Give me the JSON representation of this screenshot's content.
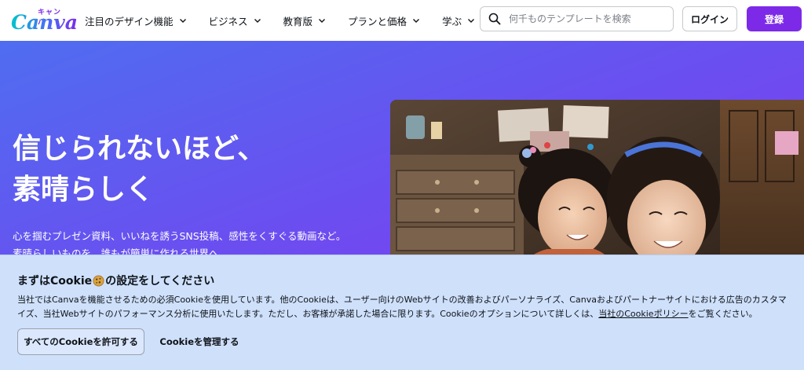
{
  "brand": {
    "logo_text": "Canva",
    "logo_kana": "キャンバ",
    "accent": "#7d2ae8"
  },
  "nav": {
    "items": [
      {
        "label": "注目のデザイン機能",
        "icon": "chevron-down-icon"
      },
      {
        "label": "ビジネス",
        "icon": "chevron-down-icon"
      },
      {
        "label": "教育版",
        "icon": "chevron-down-icon"
      },
      {
        "label": "プランと価格",
        "icon": "chevron-down-icon"
      },
      {
        "label": "学ぶ",
        "icon": "chevron-down-icon"
      }
    ]
  },
  "search": {
    "placeholder": "何千ものテンプレートを検索",
    "value": "",
    "icon": "search-icon"
  },
  "auth": {
    "login_label": "ログイン",
    "signup_label": "登録"
  },
  "hero": {
    "title_line1": "信じられないほど、",
    "title_line2": "素晴らしく",
    "subtitle_line1": "心を掴むプレゼン資料、いいねを誘うSNS投稿、感性をくすぐる動画など。",
    "subtitle_line2": "素晴らしいものを、誰もが簡単に作れる世界へ。",
    "background_colors": [
      "#4f6df0",
      "#7b3ff0"
    ]
  },
  "cookie": {
    "title_prefix": "まずはCookie",
    "title_icon": "cookie-icon",
    "title_suffix": "の設定をしてください",
    "body_text": "当社ではCanvaを機能させるための必須Cookieを使用しています。他のCookieは、ユーザー向けのWebサイトの改善およびパーソナライズ、Canvaおよびパートナーサイトにおける広告のカスタマイズ、当社Webサイトのパフォーマンス分析に使用いたします。ただし、お客様が承諾した場合に限ります。Cookieのオプションについて詳しくは、",
    "policy_link": "当社のCookieポリシー",
    "body_suffix": "をご覧ください。",
    "allow_label": "すべてのCookieを許可する",
    "manage_label": "Cookieを管理する",
    "background": "#cfe0fb"
  }
}
